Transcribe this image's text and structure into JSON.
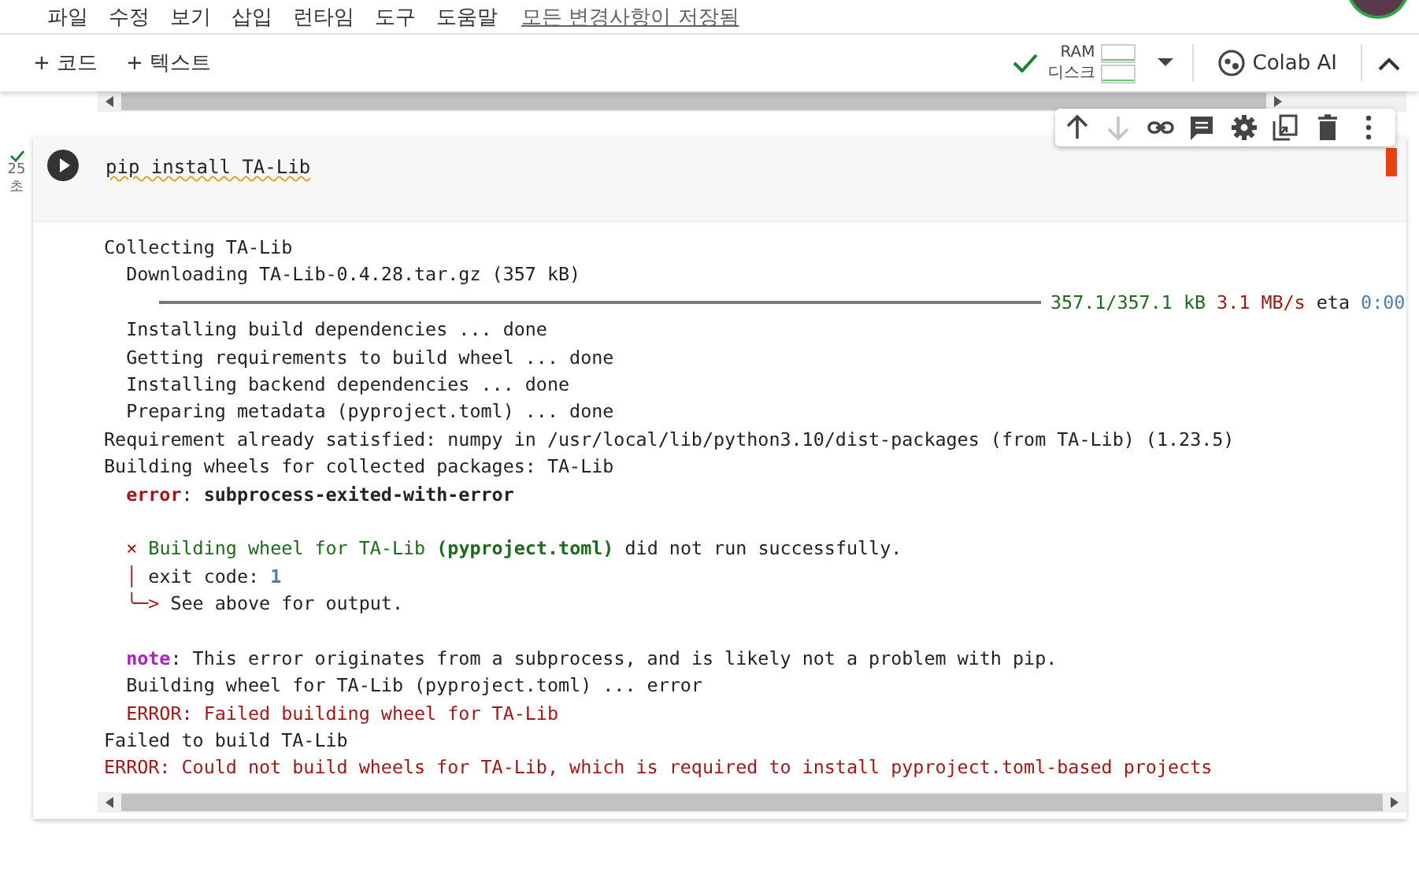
{
  "menu": [
    "파일",
    "수정",
    "보기",
    "삽입",
    "런타임",
    "도구",
    "도움말"
  ],
  "save_status": "모든 변경사항이 저장됨",
  "toolbar": {
    "add_buttons": [
      "+ 코드",
      "+ 텍스트"
    ],
    "resources": {
      "connected": true,
      "labels": [
        "RAM",
        "디스크"
      ]
    },
    "ai_button": "Colab AI"
  },
  "cell": {
    "code": "pip install TA-Lib",
    "status": {
      "succeeded": true,
      "duration": "25",
      "unit": "초"
    },
    "actions": [
      {
        "kind": "up",
        "disabled": false
      },
      {
        "kind": "down",
        "disabled": true
      },
      {
        "kind": "link",
        "disabled": false
      },
      {
        "kind": "comment",
        "disabled": false
      },
      {
        "kind": "settings",
        "disabled": false
      },
      {
        "kind": "mirror",
        "disabled": false
      },
      {
        "kind": "delete",
        "disabled": false
      },
      {
        "kind": "more",
        "disabled": false
      }
    ]
  },
  "output": [
    {
      "kind": "text",
      "gap_before": false,
      "segments": [
        {
          "text": "Collecting TA-Lib",
          "kind": "plain"
        }
      ]
    },
    {
      "kind": "text",
      "gap_before": false,
      "segments": [
        {
          "text": "  Downloading TA-Lib-0.4.28.tar.gz (357 kB)",
          "kind": "plain"
        }
      ]
    },
    {
      "kind": "progress",
      "gap_before": false,
      "level": 1,
      "segments": [
        {
          "text": "357.1/357.1 kB",
          "kind": "size"
        },
        {
          "text": " 3.1 MB/s",
          "kind": "rate"
        },
        {
          "text": " eta ",
          "kind": "plain"
        },
        {
          "text": "0:00",
          "kind": "eta"
        }
      ]
    },
    {
      "kind": "text",
      "gap_before": false,
      "segments": [
        {
          "text": "  Installing build dependencies ... done",
          "kind": "plain"
        }
      ]
    },
    {
      "kind": "text",
      "gap_before": false,
      "segments": [
        {
          "text": "  Getting requirements to build wheel ... done",
          "kind": "plain"
        }
      ]
    },
    {
      "kind": "text",
      "gap_before": false,
      "segments": [
        {
          "text": "  Installing backend dependencies ... done",
          "kind": "plain"
        }
      ]
    },
    {
      "kind": "text",
      "gap_before": false,
      "segments": [
        {
          "text": "  Preparing metadata (pyproject.toml) ... done",
          "kind": "plain"
        }
      ]
    },
    {
      "kind": "text",
      "gap_before": false,
      "segments": [
        {
          "text": "Requirement already satisfied: numpy in /usr/local/lib/python3.10/dist-packages (from TA-Lib) (1.23.5)",
          "kind": "plain"
        }
      ]
    },
    {
      "kind": "text",
      "gap_before": false,
      "segments": [
        {
          "text": "Building wheels for collected packages: TA-Lib",
          "kind": "plain"
        }
      ]
    },
    {
      "kind": "text",
      "gap_before": false,
      "segments": [
        {
          "text": "  error",
          "kind": "keyword"
        },
        {
          "text": ": ",
          "kind": "plain"
        },
        {
          "text": "subprocess-exited-with-error",
          "kind": "message"
        }
      ]
    },
    {
      "kind": "text",
      "gap_before": true,
      "segments": [
        {
          "text": "  ×",
          "kind": "marker"
        },
        {
          "text": " Building wheel for TA-Lib ",
          "kind": "failure"
        },
        {
          "text": "(pyproject.toml)",
          "kind": "path"
        },
        {
          "text": " did not run successfully.",
          "kind": "plain"
        }
      ]
    },
    {
      "kind": "text",
      "gap_before": false,
      "segments": [
        {
          "text": "  │",
          "kind": "marker"
        },
        {
          "text": " exit code: ",
          "kind": "plain"
        },
        {
          "text": "1",
          "kind": "code"
        }
      ]
    },
    {
      "kind": "text",
      "gap_before": false,
      "segments": [
        {
          "text": "  ╰─>",
          "kind": "marker"
        },
        {
          "text": " See above for output.",
          "kind": "plain"
        }
      ]
    },
    {
      "kind": "text",
      "gap_before": true,
      "segments": [
        {
          "text": "  note",
          "kind": "note"
        },
        {
          "text": ": This error originates from a subprocess, and is likely not a problem with pip.",
          "kind": "plain"
        }
      ]
    },
    {
      "kind": "text",
      "gap_before": false,
      "segments": [
        {
          "text": "  Building wheel for TA-Lib (pyproject.toml) ... error",
          "kind": "plain"
        }
      ]
    },
    {
      "kind": "text",
      "gap_before": false,
      "segments": [
        {
          "text": "  ERROR: Failed building wheel for TA-Lib",
          "kind": "error"
        }
      ]
    },
    {
      "kind": "text",
      "gap_before": false,
      "segments": [
        {
          "text": "Failed to build TA-Lib",
          "kind": "plain"
        }
      ]
    },
    {
      "kind": "text",
      "gap_before": false,
      "segments": [
        {
          "text": "ERROR: Could not build wheels for TA-Lib, which is required to install pyproject.toml-based projects",
          "kind": "error"
        }
      ]
    }
  ]
}
